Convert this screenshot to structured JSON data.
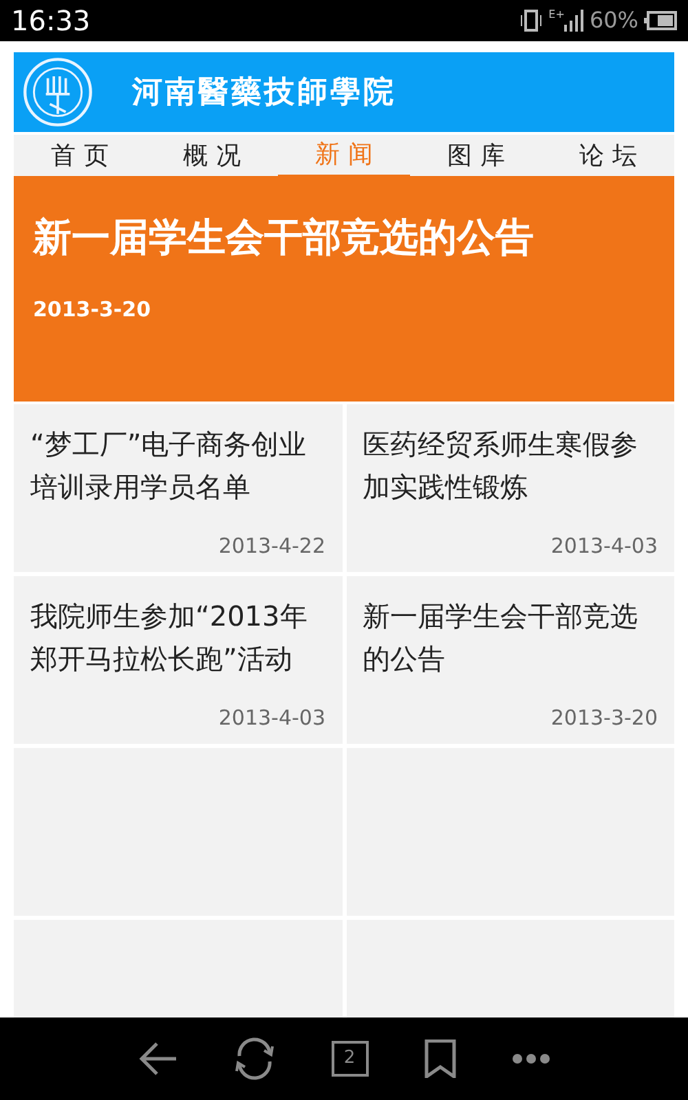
{
  "status_bar": {
    "time": "16:33",
    "network": "E+",
    "battery": "60%"
  },
  "header": {
    "school_name": "河南醫藥技師學院"
  },
  "tabs": [
    {
      "label": "首 页",
      "selected": false
    },
    {
      "label": "概 况",
      "selected": false
    },
    {
      "label": "新 闻",
      "selected": true
    },
    {
      "label": "图 库",
      "selected": false
    },
    {
      "label": "论 坛",
      "selected": false
    }
  ],
  "featured": {
    "title": "新一届学生会干部竞选的公告",
    "date": "2013-3-20"
  },
  "news": [
    {
      "kind": "article",
      "title": "“梦工厂”电子商务创业培训录用学员名单",
      "date": "2013-4-22"
    },
    {
      "kind": "article",
      "title": "医药经贸系师生寒假参加实践性锻炼",
      "date": "2013-4-03"
    },
    {
      "kind": "article",
      "title": "我院师生参加“2013年郑开马拉松长跑”活动",
      "date": "2013-4-03"
    },
    {
      "kind": "article",
      "title": "新一届学生会干部竞选的公告",
      "date": "2013-3-20"
    },
    {
      "kind": "empty"
    },
    {
      "kind": "empty"
    },
    {
      "kind": "empty"
    },
    {
      "kind": "empty"
    }
  ],
  "browser_bar": {
    "tab_count": "2"
  }
}
